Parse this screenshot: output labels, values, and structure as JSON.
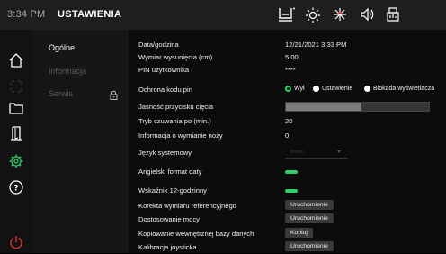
{
  "status_bar": {
    "time": "3:34 PM",
    "title": "USTAWIENIA",
    "icons": [
      "screen-reference-icon",
      "brightness-icon",
      "work-light-icon",
      "volume-icon",
      "diagnostics-icon"
    ]
  },
  "left_rail": {
    "icons": [
      "home-icon",
      "grid-icon",
      "folder-icon",
      "door-icon",
      "settings-gear-icon",
      "help-icon",
      "power-icon"
    ],
    "active_icon": "settings-gear-icon",
    "colors": {
      "active": "#2ed06a",
      "power": "#e03030"
    }
  },
  "menu": {
    "items": [
      {
        "label": "Ogólne",
        "state": "active"
      },
      {
        "label": "Informacja",
        "state": "disabled"
      },
      {
        "label": "Serwis",
        "state": "locked"
      }
    ],
    "lock_icon": "lock-icon"
  },
  "settings": {
    "date_time": {
      "label": "Data/godzina",
      "value": "12/21/2021 3:33 PM"
    },
    "overhang": {
      "label": "Wymiar wysunięcia (cm)",
      "value": "5.00"
    },
    "pin": {
      "label": "PIN użytkownika",
      "value": "****"
    },
    "pin_protection": {
      "label": "Ochrona kodu pin",
      "options": [
        "Wył",
        "Ustawienie",
        "Blokada wyświetlacza"
      ],
      "selected": "Wył"
    },
    "cut_button_brightness": {
      "label": "Jasność przycisku cięcia",
      "level_percent": 53
    },
    "standby": {
      "label": "Tryb czuwania po (min.)",
      "value": "20"
    },
    "knife_info": {
      "label": "Informacja o wymianie noży",
      "value": "0"
    },
    "language": {
      "label": "Język systemowy",
      "value": "Polski"
    },
    "english_date": {
      "label": "Angielski format daty",
      "enabled": true
    },
    "clock_12h": {
      "label": "Wskaźnik 12-godzinny",
      "enabled": true
    },
    "ref_correction": {
      "label": "Korekta wymiaru referencyjnego",
      "button": "Uruchomienie"
    },
    "power_adjust": {
      "label": "Dostosowanie mocy",
      "button": "Uruchomienie"
    },
    "internal_db_copy": {
      "label": "Kopiowanie wewnętrznej bazy danych",
      "button": "Kopiuj"
    },
    "joystick_calibration": {
      "label": "Kalibracja joysticka",
      "button": "Uruchomienie"
    }
  },
  "colors": {
    "accent": "#2ed06a",
    "background": "#000000",
    "topbar": "#1e1e1e"
  }
}
